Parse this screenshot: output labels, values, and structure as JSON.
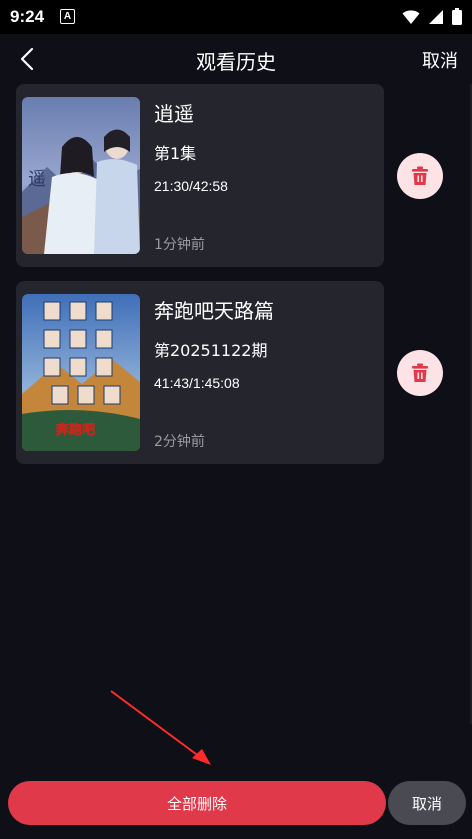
{
  "status_bar": {
    "time": "9:24",
    "notification_glyph": "A",
    "icons": [
      "wifi-icon",
      "signal-icon",
      "battery-icon"
    ]
  },
  "nav": {
    "title": "观看历史",
    "cancel_label": "取消",
    "back_icon": "chevron-left-icon"
  },
  "history": [
    {
      "title": "逍遥",
      "episode": "第1集",
      "progress": "21:30/42:58",
      "watched_ago": "1分钟前",
      "poster_icon": "poster-image"
    },
    {
      "title": "奔跑吧天路篇",
      "episode": "第20251122期",
      "progress": "41:43/1:45:08",
      "watched_ago": "2分钟前",
      "poster_icon": "poster-image"
    }
  ],
  "bottom": {
    "delete_all_label": "全部删除",
    "cancel_label": "取消"
  },
  "colors": {
    "background": "#0e0f17",
    "card": "#24252d",
    "accent": "#e0394a",
    "delete_bg": "#fde3e5",
    "cancel_bg": "#4a4b52"
  }
}
